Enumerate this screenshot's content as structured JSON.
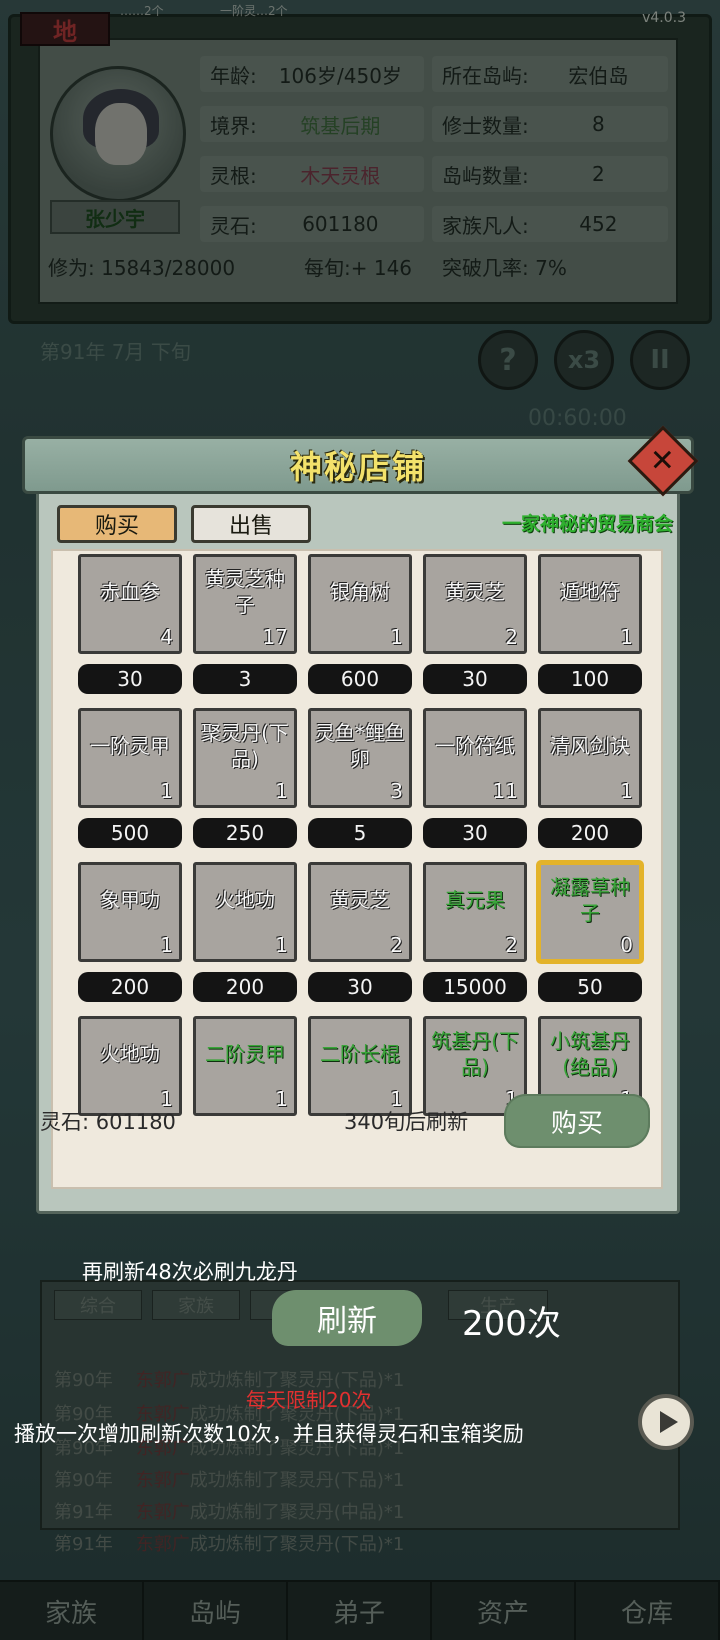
{
  "header": {
    "realm_badge": "地",
    "top_left_small": "……2个",
    "top_mid_small": "一阶灵…2个",
    "version": "v4.0.3"
  },
  "character": {
    "name": "张少宇",
    "age_label": "年龄:",
    "age_value": "106岁/450岁",
    "island_label": "所在岛屿:",
    "island_value": "宏伯岛",
    "realm_label": "境界:",
    "realm_value": "筑基后期",
    "cultivators_label": "修士数量:",
    "cultivators_value": "8",
    "root_label": "灵根:",
    "root_value": "木天灵根",
    "islands_label": "岛屿数量:",
    "islands_value": "2",
    "stones_label": "灵石:",
    "stones_value": "601180",
    "family_label": "家族凡人:",
    "family_value": "452",
    "cultivation": "修为:  15843/28000",
    "per_turn": "每旬:+ 146",
    "breakthrough": "突破几率:  7%"
  },
  "status": {
    "date": "第91年  7月  下旬",
    "timer": "00:60:00",
    "help_icon": "?",
    "speed_label": "x3",
    "pause_icon": "II"
  },
  "shop": {
    "title": "神秘店铺",
    "close_icon": "✕",
    "tab_buy": "购买",
    "tab_sell": "出售",
    "subtitle": "一家神秘的贸易商会",
    "items": [
      {
        "name": "赤血参",
        "qty": "4",
        "price": "30",
        "green": false,
        "selected": false
      },
      {
        "name": "黄灵芝种子",
        "qty": "17",
        "price": "3",
        "green": false,
        "selected": false
      },
      {
        "name": "银角树",
        "qty": "1",
        "price": "600",
        "green": false,
        "selected": false
      },
      {
        "name": "黄灵芝",
        "qty": "2",
        "price": "30",
        "green": false,
        "selected": false
      },
      {
        "name": "遁地符",
        "qty": "1",
        "price": "100",
        "green": false,
        "selected": false
      },
      {
        "name": "一阶灵甲",
        "qty": "1",
        "price": "500",
        "green": false,
        "selected": false
      },
      {
        "name": "聚灵丹(下品)",
        "qty": "1",
        "price": "250",
        "green": false,
        "selected": false
      },
      {
        "name": "灵鱼*鲤鱼卵",
        "qty": "3",
        "price": "5",
        "green": false,
        "selected": false
      },
      {
        "name": "一阶符纸",
        "qty": "11",
        "price": "30",
        "green": false,
        "selected": false
      },
      {
        "name": "清风剑诀",
        "qty": "1",
        "price": "200",
        "green": false,
        "selected": false
      },
      {
        "name": "象甲功",
        "qty": "1",
        "price": "200",
        "green": false,
        "selected": false
      },
      {
        "name": "火地功",
        "qty": "1",
        "price": "200",
        "green": false,
        "selected": false
      },
      {
        "name": "黄灵芝",
        "qty": "2",
        "price": "30",
        "green": false,
        "selected": false
      },
      {
        "name": "真元果",
        "qty": "2",
        "price": "15000",
        "green": true,
        "selected": false
      },
      {
        "name": "凝露草种子",
        "qty": "0",
        "price": "50",
        "green": true,
        "selected": true
      },
      {
        "name": "火地功",
        "qty": "1",
        "price": "",
        "green": false,
        "selected": false
      },
      {
        "name": "二阶灵甲",
        "qty": "1",
        "price": "",
        "green": true,
        "selected": false
      },
      {
        "name": "二阶长棍",
        "qty": "1",
        "price": "",
        "green": true,
        "selected": false
      },
      {
        "name": "筑基丹(下品)",
        "qty": "1",
        "price": "",
        "green": true,
        "selected": false
      },
      {
        "name": "小筑基丹(绝品)",
        "qty": "1",
        "price": "",
        "green": true,
        "selected": false
      }
    ],
    "stone_balance": "灵石: 601180",
    "refresh_after": "340旬后刷新",
    "buy_button": "购买"
  },
  "refresh": {
    "guarantee_hint": "再刷新48次必刷九龙丹",
    "button": "刷新",
    "count": "200次",
    "daily_limit": "每天限制20次",
    "ad_description": "播放一次增加刷新次数10次，并且获得灵石和宝箱奖励"
  },
  "log": {
    "tabs": [
      "综合",
      "家族",
      "弟子",
      "生产"
    ],
    "lines": [
      {
        "year": "第90年",
        "who": "东郭广",
        "text": "成功炼制了聚灵丹(下品)*1"
      },
      {
        "year": "第90年",
        "who": "东郭广",
        "text": "成功炼制了聚灵丹(下品)*1"
      },
      {
        "year": "第90年",
        "who": "东郭广",
        "text": "成功炼制了聚灵丹(下品)*1"
      },
      {
        "year": "第90年",
        "who": "东郭广",
        "text": "成功炼制了聚灵丹(下品)*1"
      },
      {
        "year": "第91年",
        "who": "东郭广",
        "text": "成功炼制了聚灵丹(中品)*1"
      },
      {
        "year": "第91年",
        "who": "东郭广",
        "text": "成功炼制了聚灵丹(下品)*1"
      }
    ]
  },
  "nav": [
    "家族",
    "岛屿",
    "弟子",
    "资产",
    "仓库"
  ]
}
